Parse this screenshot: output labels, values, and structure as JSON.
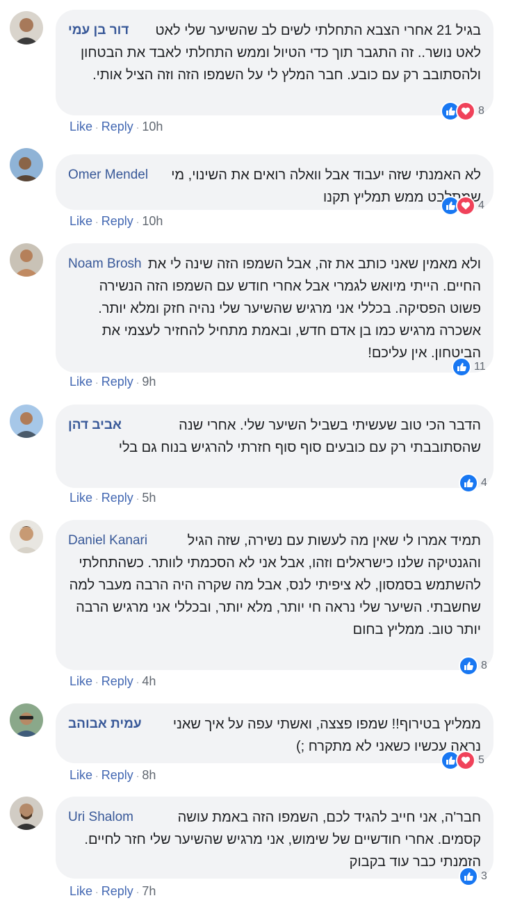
{
  "actions": {
    "like": "Like",
    "reply": "Reply",
    "dot": "·"
  },
  "colors": {
    "link": "#385898",
    "action": "#4267b2",
    "bubble": "#f2f3f5",
    "like": "#1877f2",
    "love": "#f0425a"
  },
  "comments": [
    {
      "author": "דור בן עמי",
      "text": "בגיל 21 אחרי הצבא התחלתי לשים לב שהשיער שלי לאט לאט נושר.. זה התגבר תוך כדי הטיול וממש התחלתי לאבד את הבטחון ולהסתובב רק עם כובע. חבר המלץ לי על השמפו הזה וזה הציל אותי.",
      "time": "10h",
      "reactions": [
        "like",
        "love"
      ],
      "count": "8"
    },
    {
      "author": "Omer Mendel",
      "text": "לא האמנתי שזה יעבוד אבל וואלה רואים את השינוי, מי שמתלבט ממש תמליץ תקנו",
      "time": "10h",
      "reactions": [
        "like",
        "love"
      ],
      "count": "4"
    },
    {
      "author": "Noam Brosh",
      "text": "ולא מאמין שאני כותב את זה, אבל השמפו הזה שינה לי את החיים. הייתי מיואש לגמרי אבל אחרי חודש עם השמפו הזה הנשירה פשוט הפסיקה. בכללי אני מרגיש שהשיער שלי נהיה חזק ומלא יותר. אשכרה מרגיש כמו בן אדם חדש, ובאמת מתחיל להחזיר לעצמי את הביטחון. אין עליכם!",
      "time": "9h",
      "reactions": [
        "like"
      ],
      "count": "11"
    },
    {
      "author": "אביב דהן",
      "text": "הדבר הכי טוב שעשיתי בשביל השיער שלי. אחרי שנה שהסתובבתי רק עם כובעים סוף סוף חזרתי להרגיש בנוח גם בלי",
      "time": "5h",
      "reactions": [
        "like"
      ],
      "count": "4"
    },
    {
      "author": "Daniel Kanari",
      "text": "תמיד אמרו לי שאין מה לעשות עם נשירה, שזה הגיל והגנטיקה שלנו כישראלים וזהו, אבל אני לא הסכמתי לוותר. כשהתחלתי להשתמש בסמסון, לא ציפיתי לנס, אבל מה שקרה היה הרבה מעבר למה שחשבתי. השיער שלי נראה חי יותר, מלא יותר, ובכללי אני מרגיש הרבה יותר טוב. ממליץ בחום",
      "time": "4h",
      "reactions": [
        "like"
      ],
      "count": "8"
    },
    {
      "author": "עמית אבוהב",
      "text": "ממליץ בטירוף!! שמפו פצצה, ואשתי עפה על איך שאני נראה עכשיו כשאני לא מתקרח ;)",
      "time": "8h",
      "reactions": [
        "like",
        "love"
      ],
      "count": "5"
    },
    {
      "author": "Uri Shalom",
      "text": "חבר'ה, אני חייב להגיד לכם, השמפו הזה באמת עושה קסמים. אחרי חודשיים של שימוש, אני מרגיש שהשיער שלי חזר לחיים. הזמנתי כבר עוד בקבוק",
      "time": "7h",
      "reactions": [
        "like"
      ],
      "count": "3"
    }
  ]
}
